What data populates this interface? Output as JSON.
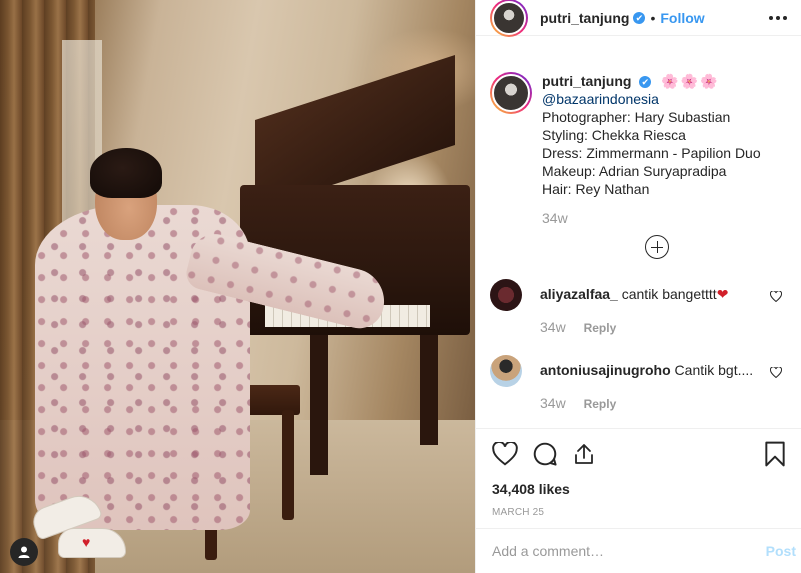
{
  "post": {
    "username": "putri_tanjung",
    "follow_label": "Follow",
    "dot": "•",
    "verified_glyph": "✔"
  },
  "caption": {
    "username": "putri_tanjung",
    "flowers": "🌸🌸🌸",
    "lines": [
      "@bazaarindonesia",
      "Photographer: Hary Subastian",
      "Styling: Chekka Riesca",
      "Dress: Zimmermann - Papilion Duo",
      "Makeup: Adrian Suryapradipa",
      "Hair: Rey Nathan"
    ],
    "time": "34w"
  },
  "comments": [
    {
      "username": "aliyazalfaa_",
      "text": "cantik bangetttt",
      "emoji": "❤",
      "time": "34w",
      "reply_label": "Reply"
    },
    {
      "username": "antoniusajinugroho",
      "text": "Cantik bgt....",
      "emoji": "",
      "time": "34w",
      "reply_label": "Reply"
    }
  ],
  "likes": "34,408 likes",
  "date": "MARCH 25",
  "comment_input": {
    "placeholder": "Add a comment…",
    "value": ""
  },
  "post_button": "Post",
  "colors": {
    "accent": "#3897f0",
    "muted": "#999999",
    "post_disabled": "#b2dffc"
  },
  "icons": [
    "more-icon",
    "load-more-icon",
    "heart-icon",
    "comment-icon",
    "share-icon",
    "bookmark-icon",
    "user-icon"
  ]
}
